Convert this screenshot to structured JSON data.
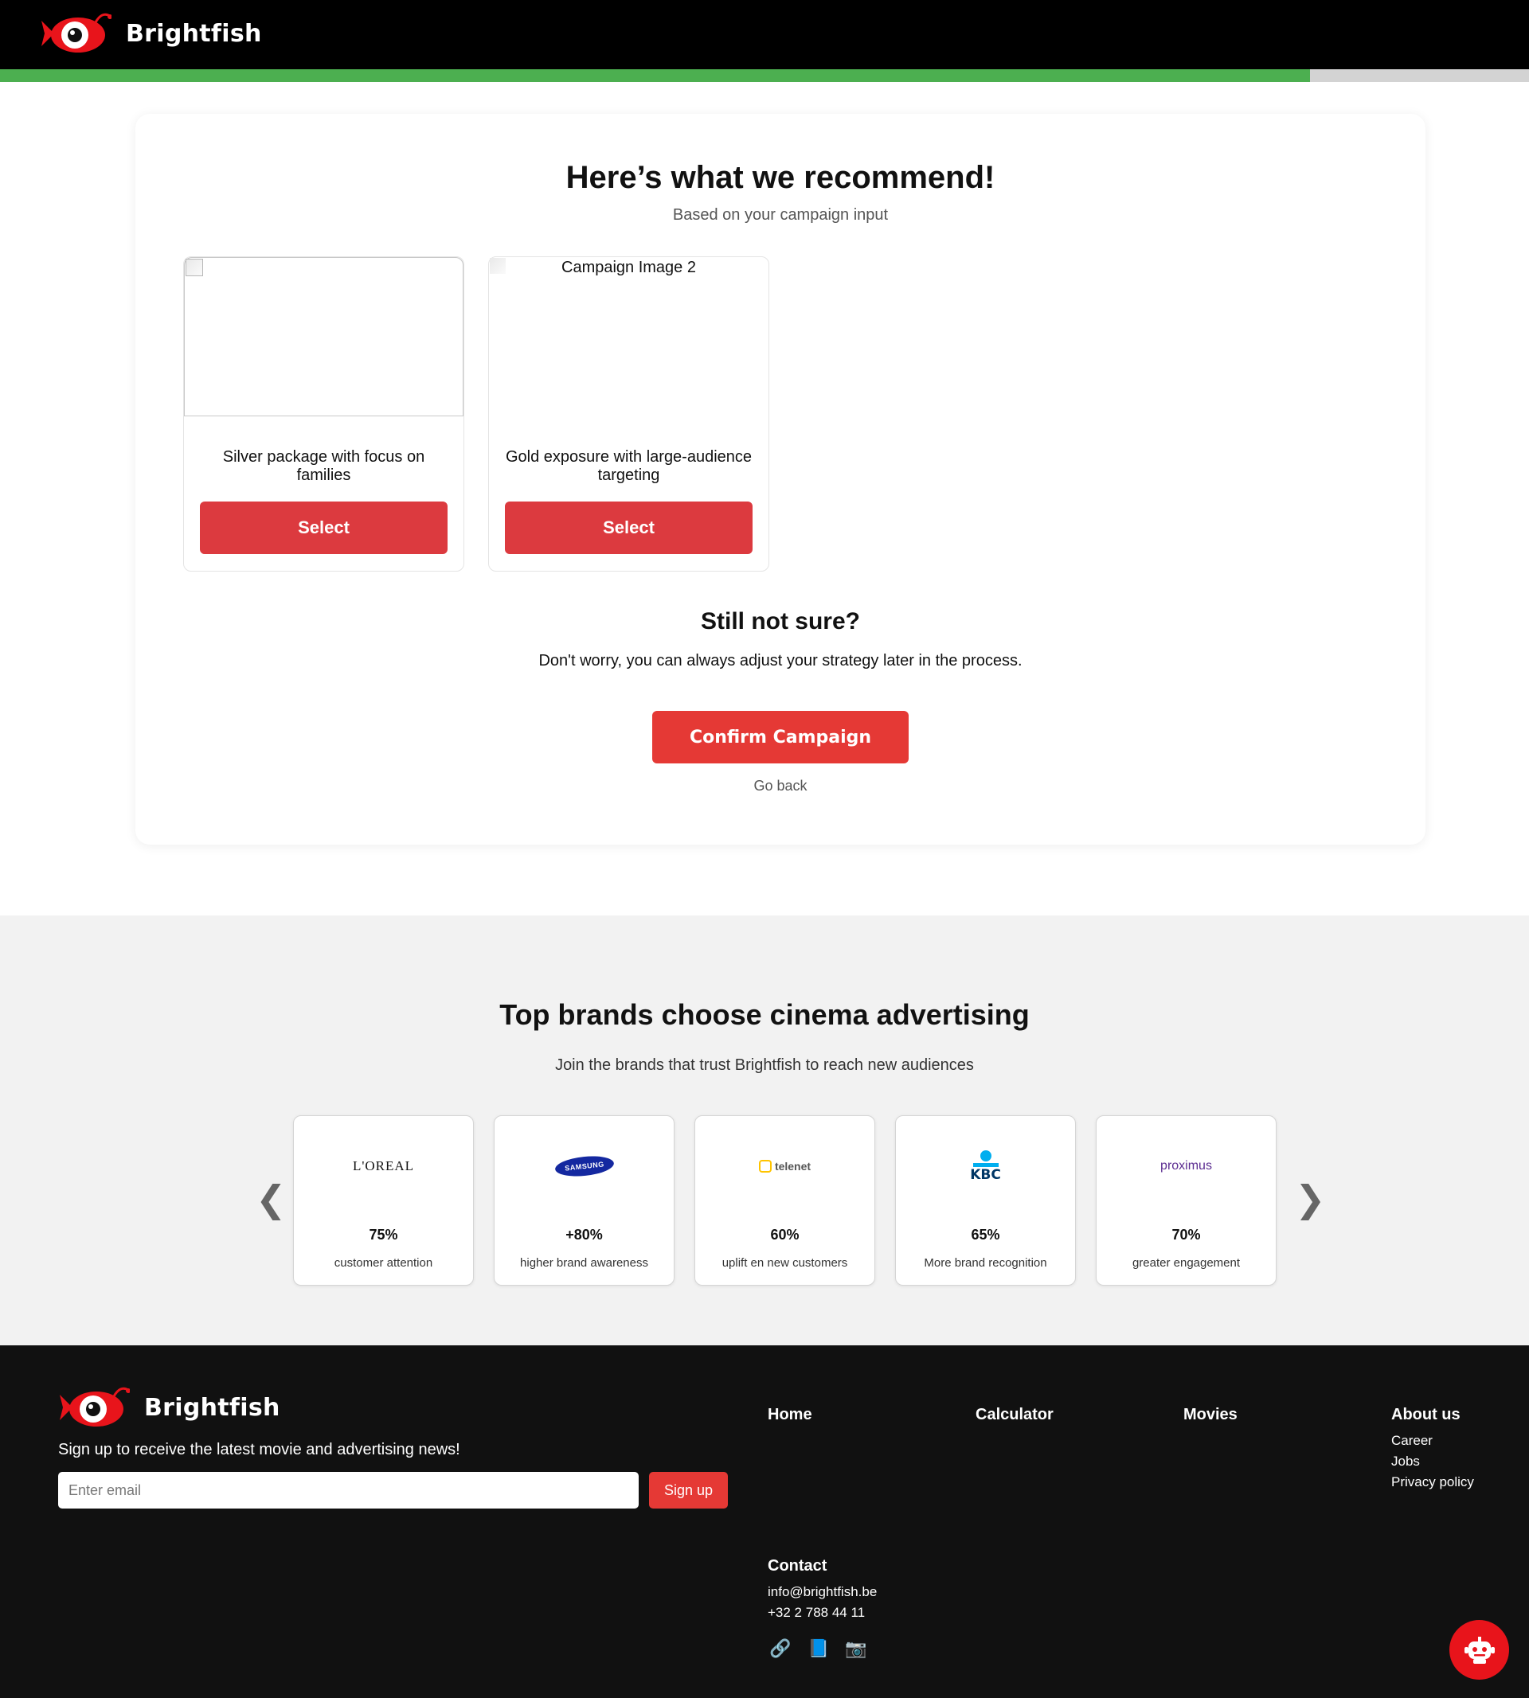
{
  "header": {
    "brand": "Brightfish",
    "progress": 0.857
  },
  "recommend": {
    "title": "Here’s what we recommend!",
    "subtitle": "Based on your campaign input",
    "packages": [
      {
        "image_alt": "",
        "description": "Silver package with focus on families",
        "button": "Select"
      },
      {
        "image_alt": "Campaign Image 2",
        "description": "Gold exposure with large-audience targeting",
        "button": "Select"
      }
    ],
    "still_title": "Still not sure?",
    "still_text": "Don't worry, you can always adjust your strategy later in the process.",
    "confirm_button": "Confirm Campaign",
    "go_back": "Go back"
  },
  "brands": {
    "title": "Top brands choose cinema advertising",
    "lead": "Join the brands that trust Brightfish to reach new audiences",
    "prev": "❮",
    "next": "❯",
    "items": [
      {
        "logo": "L'OREAL",
        "stat": "75%",
        "label": "customer attention"
      },
      {
        "logo": "SAMSUNG",
        "stat": "+80%",
        "label": "higher brand awareness"
      },
      {
        "logo": "telenet",
        "stat": "60%",
        "label": "uplift en new customers"
      },
      {
        "logo": "KBC",
        "stat": "65%",
        "label": "More brand recognition"
      },
      {
        "logo": "proximus",
        "stat": "70%",
        "label": "greater engagement"
      }
    ]
  },
  "footer": {
    "brand": "Brightfish",
    "newsletter_text": "Sign up to receive the latest movie and advertising news!",
    "email_placeholder": "Enter email",
    "signup_button": "Sign up",
    "nav": {
      "home": "Home",
      "calculator": "Calculator",
      "movies": "Movies",
      "about": "About us",
      "about_links": [
        "Career",
        "Jobs",
        "Privacy policy"
      ]
    },
    "contact": {
      "title": "Contact",
      "email": "info@brightfish.be",
      "phone": "+32 2 788 44 11"
    },
    "social": [
      {
        "icon": "link-icon",
        "glyph": "🔗"
      },
      {
        "icon": "book-icon",
        "glyph": "📘"
      },
      {
        "icon": "camera-icon",
        "glyph": "📷"
      }
    ]
  },
  "colors": {
    "accent_red": "#e53935",
    "select_red": "#dc3a3f",
    "progress_green": "#4caf50"
  }
}
